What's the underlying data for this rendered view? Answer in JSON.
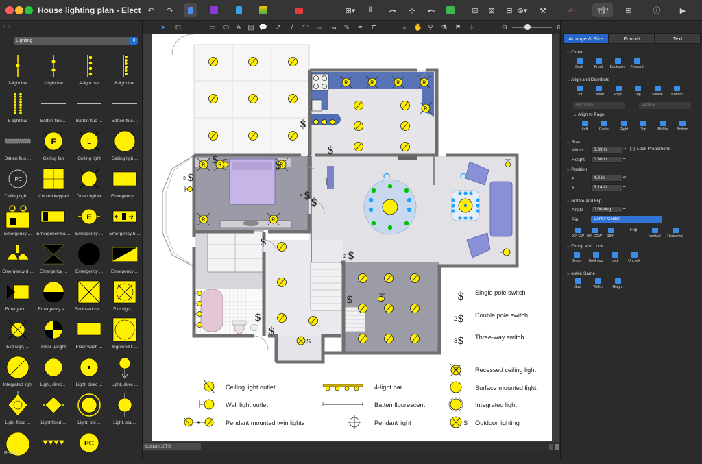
{
  "window": {
    "title": "House lighting plan - Electrical a..."
  },
  "library": {
    "category": "Lighting",
    "items": [
      {
        "label": "1-light bar",
        "icon": "bar-1-icon"
      },
      {
        "label": "2-light bar",
        "icon": "bar-2-icon"
      },
      {
        "label": "4-light bar",
        "icon": "bar-4-icon"
      },
      {
        "label": "6-light bar",
        "icon": "bar-6-icon"
      },
      {
        "label": "8-light bar",
        "icon": "bar-8-icon"
      },
      {
        "label": "Batten fluo ...",
        "icon": "batten-thin-icon"
      },
      {
        "label": "Batten fluo ...",
        "icon": "batten-thin-icon"
      },
      {
        "label": "Batten fluo ...",
        "icon": "batten-thin-icon"
      },
      {
        "label": "Batten fluo ...",
        "icon": "batten-thick-icon"
      },
      {
        "label": "Ceiling fan",
        "icon": "ceiling-fan-icon"
      },
      {
        "label": "Ceiling light",
        "icon": "ceiling-light-icon"
      },
      {
        "label": "Ceiling ligh ...",
        "icon": "ceiling-light-plain-icon"
      },
      {
        "label": "Ceiling ligh ...",
        "icon": "ceiling-pc-icon"
      },
      {
        "label": "Control keypad",
        "icon": "keypad-icon"
      },
      {
        "label": "Down lighter",
        "icon": "down-lighter-icon"
      },
      {
        "label": "Emergency ...",
        "icon": "emergency-rect-icon"
      },
      {
        "label": "Emergency ...",
        "icon": "emergency-box-icon"
      },
      {
        "label": "Emergency ba ...",
        "icon": "emergency-battery-icon"
      },
      {
        "label": "Emergency ...",
        "icon": "emergency-e-icon"
      },
      {
        "label": "Emergency b ...",
        "icon": "emergency-exit-sign-icon"
      },
      {
        "label": "Emergency d ...",
        "icon": "emergency-d-icon"
      },
      {
        "label": "Emergency ...",
        "icon": "emergency-hourglass-icon"
      },
      {
        "label": "Emergency ...",
        "icon": "emergency-black-circle-icon"
      },
      {
        "label": "Emergency ...",
        "icon": "emergency-diagonal-icon"
      },
      {
        "label": "Emergenc ...",
        "icon": "emergency-arrow-icon"
      },
      {
        "label": "Emergency s ...",
        "icon": "emergency-split-icon"
      },
      {
        "label": "Enclosed ce ...",
        "icon": "enclosed-ceiling-icon"
      },
      {
        "label": "Exit sign, ...",
        "icon": "exit-sign-icon"
      },
      {
        "label": "Exit sign, ...",
        "icon": "exit-sign-circle-icon"
      },
      {
        "label": "Floor uplight",
        "icon": "floor-uplight-icon"
      },
      {
        "label": "Floor wash ...",
        "icon": "floor-wash-icon"
      },
      {
        "label": "Inground li ...",
        "icon": "inground-light-icon"
      },
      {
        "label": "Integrated light",
        "icon": "integrated-light-icon"
      },
      {
        "label": "Light, direc ...",
        "icon": "light-directional-icon"
      },
      {
        "label": "Light, direc ...",
        "icon": "light-directional-2-icon"
      },
      {
        "label": "Light, direc ...",
        "icon": "light-directional-3-icon"
      },
      {
        "label": "Light flood ...",
        "icon": "light-flood-icon"
      },
      {
        "label": "Light flood ...",
        "icon": "light-flood-2-icon"
      },
      {
        "label": "Light, pol ...",
        "icon": "light-pole-icon"
      },
      {
        "label": "Light, sta ...",
        "icon": "light-standard-icon"
      },
      {
        "label": "",
        "icon": "light-large-icon"
      },
      {
        "label": "",
        "icon": "light-triangles-icon"
      },
      {
        "label": "",
        "icon": "light-pc-icon"
      },
      {
        "label": "",
        "icon": "empty"
      }
    ]
  },
  "status": {
    "ready": "Ready",
    "zoom": "Custom 107%"
  },
  "inspector": {
    "tabs": [
      "Arrange & Size",
      "Format",
      "Text"
    ],
    "order": {
      "title": "Order",
      "buttons": [
        "Back",
        "Front",
        "Backward",
        "Forward"
      ]
    },
    "align": {
      "title": "Align and Distribute",
      "buttons": [
        "Left",
        "Center",
        "Right",
        "Top",
        "Middle",
        "Bottom"
      ],
      "horizontal": "Horizontal",
      "vertical": "Vertical",
      "page_title": "Align to Page",
      "page_buttons": [
        "Left",
        "Center",
        "Right",
        "Top",
        "Middle",
        "Bottom"
      ]
    },
    "size": {
      "title": "Size",
      "width_label": "Width:",
      "width": "0.39 in",
      "height_label": "Height",
      "height": "0.38 in",
      "lock": "Lock Proportions"
    },
    "position": {
      "title": "Position",
      "x_label": "X",
      "x": "4.3 in",
      "y_label": "Y",
      "y": "3.14 in"
    },
    "rotate": {
      "title": "Rotate and Flip",
      "angle_label": "Angle",
      "angle": "0.00 deg",
      "pin_label": "Pin",
      "pin": "Center-Center",
      "buttons": [
        "90° CW",
        "90° CCW",
        "180°"
      ],
      "flip_label": "Flip",
      "flip_buttons": [
        "Vertical",
        "Horizontal"
      ]
    },
    "group": {
      "title": "Group and Lock",
      "buttons": [
        "Group",
        "UnGroup",
        "Lock",
        "UnLock"
      ]
    },
    "make_same": {
      "title": "Make Same",
      "buttons": [
        "Size",
        "Width",
        "Height"
      ]
    }
  },
  "legend": {
    "single_pole": "Single pole switch",
    "double_pole": "Double pole switch",
    "three_way": "Three-way switch",
    "recessed": "Recessed ceiling light",
    "surface": "Surface mounted light",
    "integrated": "Integrated light",
    "outdoor": "Outdoor lighting",
    "ceiling_outlet": "Ceiling light outlet",
    "wall_outlet": "Wall light outlet",
    "pendant_twin": "Pendant mounted twin lights",
    "four_bar": "4-light bar",
    "batten": "Batten fluorescent",
    "pendant": "Pendant light",
    "sym_r": "R",
    "sym_s": "S",
    "sym_pc": "PC",
    "sym_f": "F",
    "sym_l": "L",
    "sym_e": "E",
    "sym_2": "2",
    "sym_3": "3"
  },
  "colors": {
    "light_yellow": "#ffef00",
    "accent_blue": "#2966c9",
    "floor_dark": "#9a9aa8",
    "floor_light": "#e4e4ea"
  }
}
